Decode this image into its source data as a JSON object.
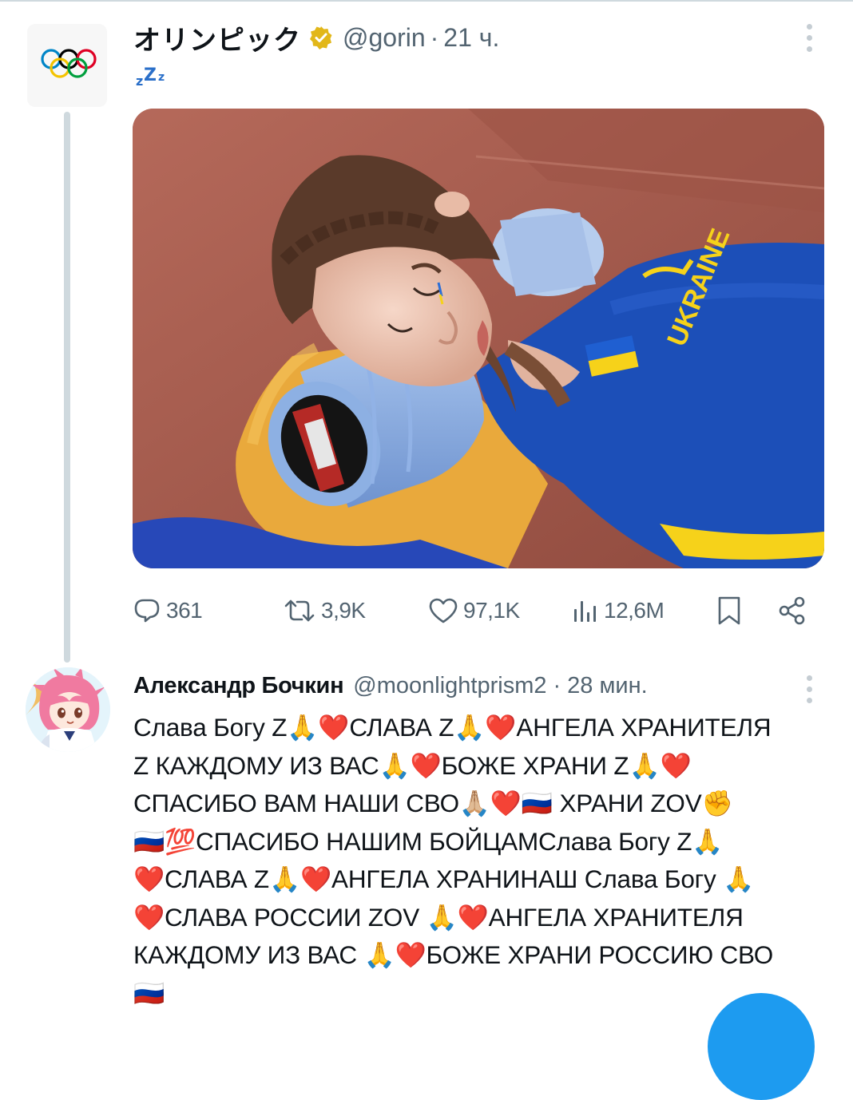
{
  "tweet1": {
    "author_name": "オリンピック",
    "handle": "@gorin",
    "separator": "·",
    "time": "21 ч.",
    "sleep_emoji": "zzz",
    "photo": {
      "jersey_text": "UKRAINE"
    },
    "actions": {
      "replies": "361",
      "retweets": "3,9K",
      "likes": "97,1K",
      "views": "12,6M"
    }
  },
  "tweet2": {
    "author_name": "Александр Бочкин",
    "handle": "@moonlightprism2",
    "separator": "·",
    "time": "28 мин.",
    "lines": [
      "Слава Богу Z🙏❤️СЛАВА Z🙏❤️АНГЕЛА ХРАНИТЕЛЯ",
      "Z КАЖДОМУ ИЗ ВАС🙏❤️БОЖЕ ХРАНИ Z🙏❤️",
      "СПАСИБО ВАМ НАШИ СВО🙏🏼❤️🇷🇺 ХРАНИ ZOV✊",
      "🇷🇺💯СПАСИБО НАШИМ БОЙЦАМСлава Богу Z🙏",
      "❤️СЛАВА Z🙏❤️АНГЕЛА ХРАНИНАШ Слава Богу 🙏",
      "❤️СЛАВА РОССИИ ZOV 🙏❤️АНГЕЛА ХРАНИТЕЛЯ",
      "КАЖДОМУ ИЗ ВАС 🙏❤️БОЖЕ ХРАНИ РОССИЮ СВО",
      "🇷🇺"
    ]
  },
  "icons": {
    "reply": "reply-icon",
    "retweet": "retweet-icon",
    "like": "heart-icon",
    "views": "views-chart-icon",
    "bookmark": "bookmark-icon",
    "share": "share-icon",
    "more": "more-vertical-icon",
    "verified": "verified-badge-icon"
  },
  "colors": {
    "accent": "#1d9bf0",
    "verified_gold": "#e2b719",
    "secondary_text": "#536471",
    "jersey_blue": "#1c4fb8",
    "ukraine_yellow": "#f6d21a",
    "track_red": "#a85c4d"
  }
}
